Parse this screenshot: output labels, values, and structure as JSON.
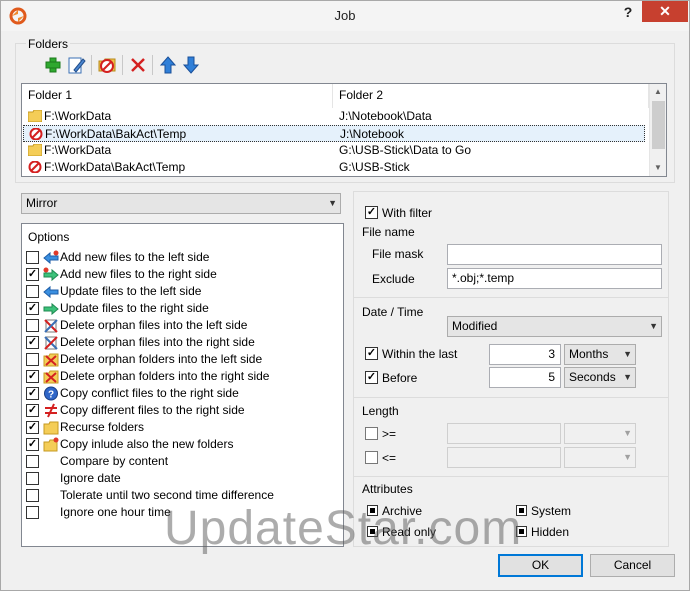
{
  "window": {
    "title": "Job",
    "help_glyph": "?",
    "close_glyph": "✕"
  },
  "folders": {
    "label": "Folders",
    "toolbar": [
      "add-icon",
      "edit-icon",
      "exclude-icon",
      "delete-icon",
      "move-up-icon",
      "move-down-icon"
    ],
    "headers": [
      "Folder 1",
      "Folder 2"
    ],
    "rows": [
      {
        "icon": "folder-icon",
        "folder1": "F:\\WorkData",
        "folder2": "J:\\Notebook\\Data",
        "selected": false
      },
      {
        "icon": "blocked-folder-icon",
        "folder1": "F:\\WorkData\\BakAct\\Temp",
        "folder2": "J:\\Notebook",
        "selected": true
      },
      {
        "icon": "folder-icon",
        "folder1": "F:\\WorkData",
        "folder2": "G:\\USB-Stick\\Data to Go",
        "selected": false
      },
      {
        "icon": "blocked-folder-icon",
        "folder1": "F:\\WorkData\\BakAct\\Temp",
        "folder2": "G:\\USB-Stick",
        "selected": false
      }
    ]
  },
  "mode": {
    "value": "Mirror"
  },
  "options": {
    "label": "Options",
    "items": [
      {
        "text": "Add new files to the left side",
        "checked": false,
        "icon": "arrow-left-new-icon"
      },
      {
        "text": "Add new files to the right side",
        "checked": true,
        "icon": "arrow-right-new-icon"
      },
      {
        "text": "Update files to the left side",
        "checked": false,
        "icon": "arrow-left-icon"
      },
      {
        "text": "Update files to the right side",
        "checked": true,
        "icon": "arrow-right-icon"
      },
      {
        "text": "Delete orphan files into the left side",
        "checked": false,
        "icon": "delete-left-icon"
      },
      {
        "text": "Delete orphan files into the right side",
        "checked": true,
        "icon": "delete-right-icon"
      },
      {
        "text": "Delete orphan folders into the left side",
        "checked": false,
        "icon": "delete-folder-left-icon"
      },
      {
        "text": "Delete orphan folders into the right side",
        "checked": true,
        "icon": "delete-folder-right-icon"
      },
      {
        "text": "Copy conflict files to the right side",
        "checked": true,
        "icon": "conflict-icon"
      },
      {
        "text": "Copy different files to the right side",
        "checked": true,
        "icon": "not-equal-icon"
      },
      {
        "text": "Recurse folders",
        "checked": true,
        "icon": "folder-icon"
      },
      {
        "text": "Copy inlude also the new folders",
        "checked": true,
        "icon": "new-folder-icon"
      },
      {
        "text": "Compare by content",
        "checked": false,
        "icon": ""
      },
      {
        "text": "Ignore date",
        "checked": false,
        "icon": ""
      },
      {
        "text": "Tolerate until two second time difference",
        "checked": false,
        "icon": ""
      },
      {
        "text": "Ignore one hour time",
        "checked": false,
        "icon": ""
      }
    ]
  },
  "filter": {
    "with_filter_label": "With filter",
    "with_filter_checked": true,
    "file_name": {
      "label": "File name",
      "mask_label": "File mask",
      "mask_value": "",
      "exclude_label": "Exclude",
      "exclude_value": "*.obj;*.temp"
    },
    "date_time": {
      "label": "Date / Time",
      "mode": "Modified",
      "within_label": "Within the last",
      "within_checked": true,
      "within_value": "3",
      "within_unit": "Months",
      "before_label": "Before",
      "before_checked": true,
      "before_value": "5",
      "before_unit": "Seconds"
    },
    "length": {
      "label": "Length",
      "ge_label": ">=",
      "le_label": "<="
    },
    "attributes": {
      "label": "Attributes",
      "archive": "Archive",
      "system": "System",
      "read_only": "Read only",
      "hidden": "Hidden"
    }
  },
  "buttons": {
    "ok": "OK",
    "cancel": "Cancel"
  },
  "watermark": "UpdateStar.com",
  "colors": {
    "close": "#c7402f",
    "accent": "#0078d7",
    "selection": "#e5f1fb"
  }
}
